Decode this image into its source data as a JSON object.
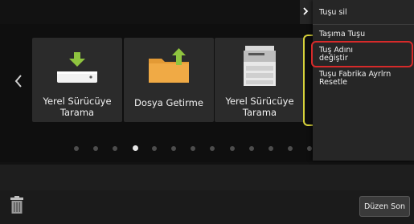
{
  "tiles": [
    {
      "label_line1": "Yerel Sürücüye",
      "label_line2": "Tarama",
      "icon": "usb-drive-download-icon"
    },
    {
      "label_line1": "Dosya Getirme",
      "label_line2": "",
      "icon": "folder-upload-icon"
    },
    {
      "label_line1": "Yerel Sürücüye",
      "label_line2": "Tarama",
      "icon": "printer-icon"
    }
  ],
  "menu": {
    "items": [
      {
        "label": "Tuşu sil"
      },
      {
        "label": "Taşıma Tuşu"
      },
      {
        "label_line1": "Tuş Adını",
        "label_line2": "değiştir"
      },
      {
        "label_line1": "Tuşu Fabrika Ayrlrn",
        "label_line2": "Resetle"
      }
    ]
  },
  "pagination": {
    "total": 14,
    "active_index": 3
  },
  "footer": {
    "end_edit_label": "Düzen Son"
  },
  "colors": {
    "highlight_yellow": "#d8d33b",
    "highlight_red": "#d62a2a",
    "accent_green": "#8fc43f",
    "folder_orange": "#e39a35"
  }
}
